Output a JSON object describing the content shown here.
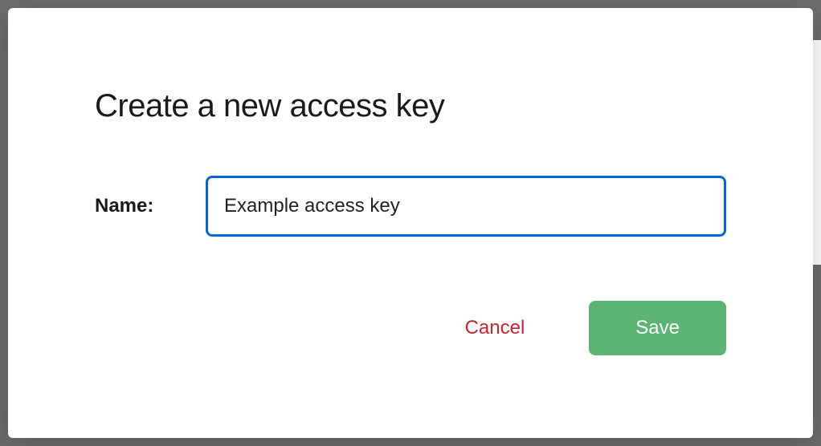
{
  "modal": {
    "title": "Create a new access key",
    "name_label": "Name:",
    "name_value": "Example access key",
    "cancel_label": "Cancel",
    "save_label": "Save"
  }
}
